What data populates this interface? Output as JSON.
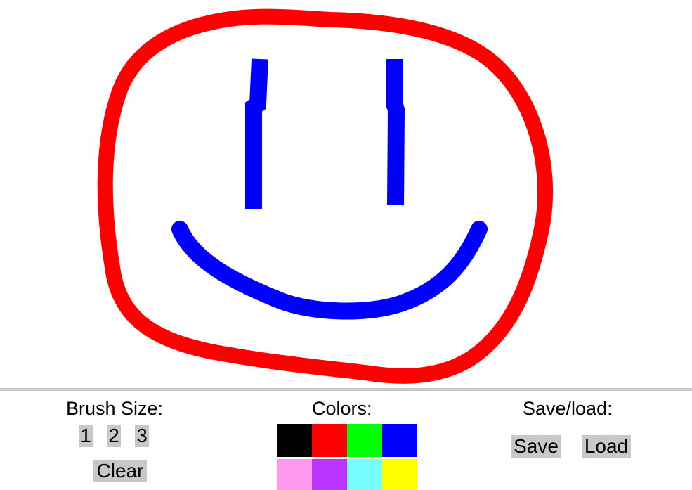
{
  "toolbar": {
    "brush_size_label": "Brush Size:",
    "brush_sizes": [
      "1",
      "2",
      "3"
    ],
    "clear_label": "Clear",
    "colors_label": "Colors:",
    "save_load_label": "Save/load:",
    "save_label": "Save",
    "load_label": "Load"
  },
  "palette": {
    "black": "#000000",
    "red": "#ff0000",
    "green": "#00ff00",
    "blue": "#0000ff",
    "pink": "#ff99ee",
    "purple": "#bb33ff",
    "cyan": "#77ffff",
    "yellow": "#ffff00"
  },
  "drawing": {
    "stroke_colors": {
      "face": "#ff0000",
      "features": "#0000ff"
    }
  }
}
